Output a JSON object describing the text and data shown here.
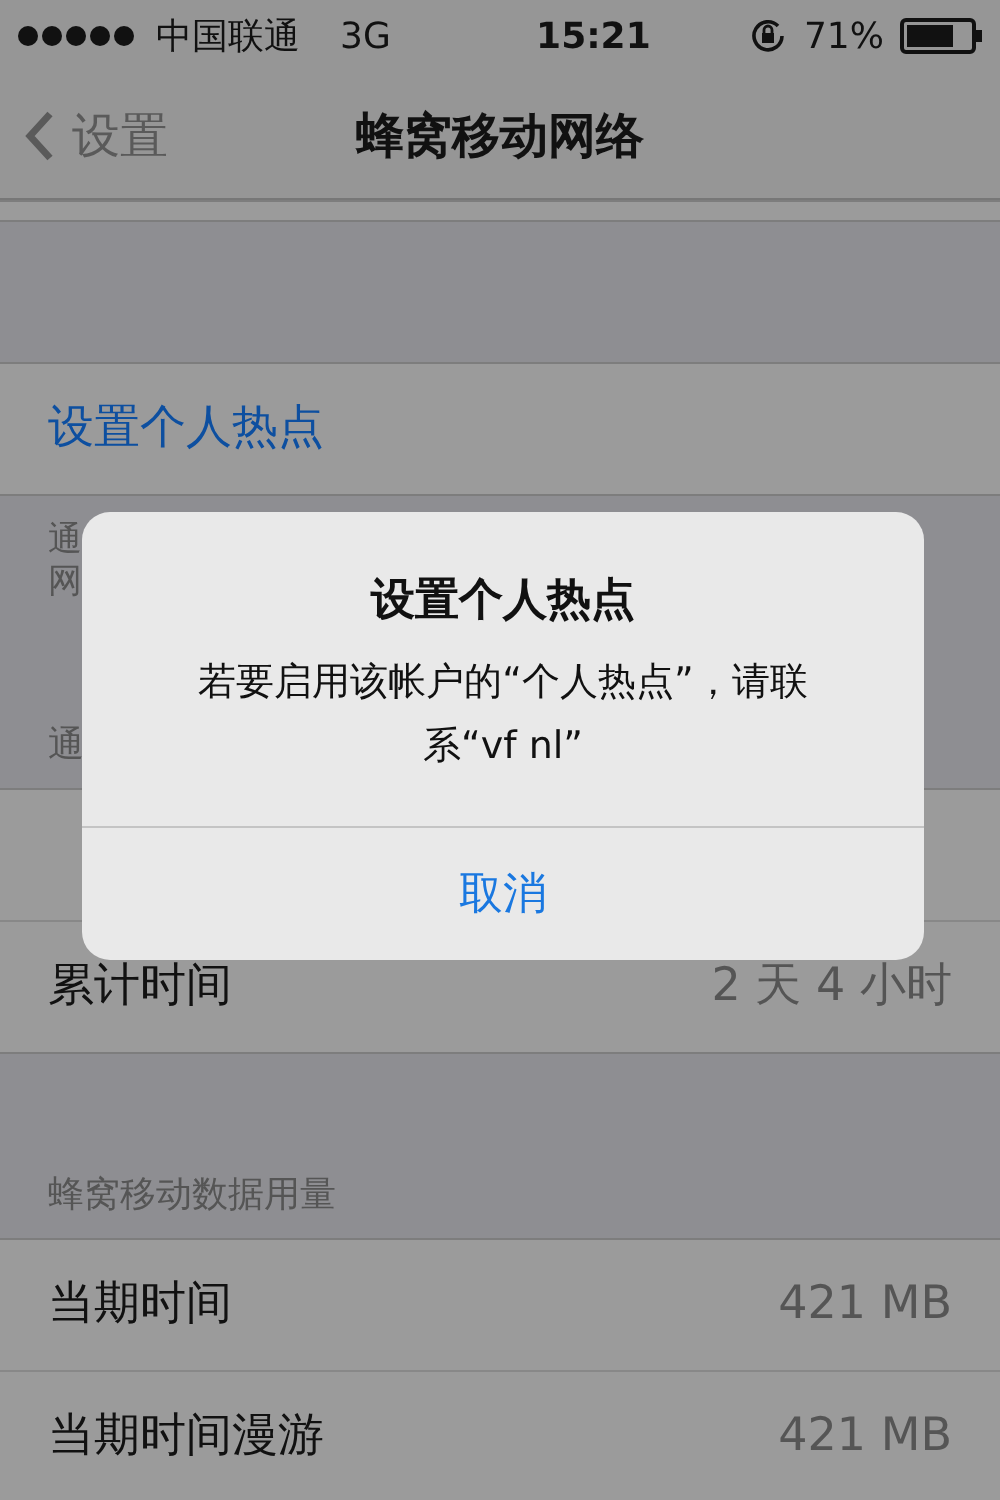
{
  "status_bar": {
    "carrier": "中国联通",
    "network": "3G",
    "time": "15:21",
    "battery_text": "71%"
  },
  "nav_bar": {
    "back_label": "设置",
    "title": "蜂窝移动网络"
  },
  "sections": [
    {
      "rows": [
        {
          "kind": "cut"
        }
      ]
    },
    {
      "rows": [
        {
          "kind": "link",
          "label": "设置个人热点"
        }
      ],
      "footer_lines": [
        "通",
        "网"
      ]
    },
    {
      "header": "通",
      "rows": [
        {
          "kind": "covered"
        },
        {
          "kind": "value",
          "label": "累计时间",
          "value": "2 天 4 小时"
        }
      ]
    },
    {
      "header": "蜂窝移动数据用量",
      "rows": [
        {
          "kind": "value",
          "label": "当期时间",
          "value": "421 MB"
        },
        {
          "kind": "value",
          "label": "当期时间漫游",
          "value": "421 MB"
        }
      ]
    }
  ],
  "alert": {
    "title": "设置个人热点",
    "message": "若要启用该帐户的“个人热点”，请联系“vf nl”",
    "buttons": [
      "取消"
    ]
  }
}
